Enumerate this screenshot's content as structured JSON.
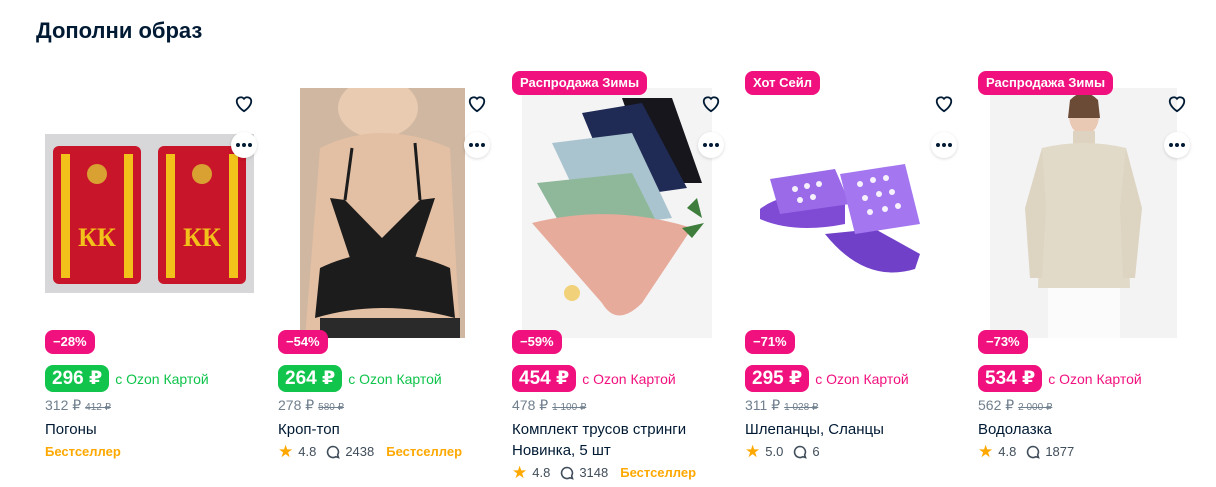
{
  "section": {
    "title": "Дополни образ"
  },
  "colors": {
    "pink": "#f1117e",
    "green": "#10c44c",
    "orange": "#ffa800",
    "text": "#001a34",
    "muted": "#707f8d"
  },
  "cards": [
    {
      "promo": "",
      "discount": "−28%",
      "price": "296 ₽",
      "card_label": "с Ozon Картой",
      "old_price": "312 ₽",
      "strike_price": "412 ₽",
      "name_line1": "Погоны",
      "name_line2": "",
      "badge": "Бестселлер",
      "rating": "",
      "reviews": ""
    },
    {
      "promo": "",
      "discount": "−54%",
      "price": "264 ₽",
      "card_label": "с Ozon Картой",
      "old_price": "278 ₽",
      "strike_price": "580 ₽",
      "name_line1": "Кроп-топ",
      "name_line2": "",
      "badge": "Бестселлер",
      "rating": "4.8",
      "reviews": "2438"
    },
    {
      "promo": "Распродажа Зимы",
      "discount": "−59%",
      "price": "454 ₽",
      "card_label": "с Ozon Картой",
      "old_price": "478 ₽",
      "strike_price": "1 100 ₽",
      "name_line1": "Комплект трусов стринги",
      "name_line2": "Новинка, 5 шт",
      "badge": "Бестселлер",
      "rating": "4.8",
      "reviews": "3148"
    },
    {
      "promo": "Хот Сейл",
      "discount": "−71%",
      "price": "295 ₽",
      "card_label": "с Ozon Картой",
      "old_price": "311 ₽",
      "strike_price": "1 028 ₽",
      "name_line1": "Шлепанцы, Сланцы",
      "name_line2": "",
      "badge": "",
      "rating": "5.0",
      "reviews": "6"
    },
    {
      "promo": "Распродажа Зимы",
      "discount": "−73%",
      "price": "534 ₽",
      "card_label": "с Ozon Картой",
      "old_price": "562 ₽",
      "strike_price": "2 000 ₽",
      "name_line1": "Водолазка",
      "name_line2": "",
      "badge": "",
      "rating": "4.8",
      "reviews": "1877"
    }
  ]
}
